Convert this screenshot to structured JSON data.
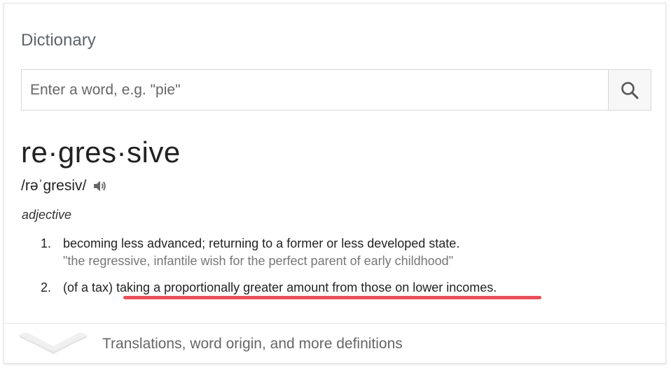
{
  "title": "Dictionary",
  "search": {
    "placeholder": "Enter a word, e.g. \"pie\"",
    "value": "",
    "icon": "search-icon"
  },
  "entry": {
    "headword": "re·gres·sive",
    "pronunciation": "/rəˈɡresiv/",
    "audio_icon": "speaker-icon",
    "part_of_speech": "adjective",
    "definitions": [
      {
        "number": "1.",
        "prefix": "",
        "text": "becoming less advanced; returning to a former or less developed state.",
        "example": "\"the regressive, infantile wish for the perfect parent of early childhood\""
      },
      {
        "number": "2.",
        "prefix": "(of a tax) ",
        "text": "taking a proportionally greater amount from those on lower incomes.",
        "example": ""
      }
    ]
  },
  "footer": {
    "label": "Translations, word origin, and more definitions",
    "icon": "chevron-down-icon"
  },
  "colors": {
    "highlight_underline": "#e8505b",
    "text": "#222222",
    "muted": "#777777"
  }
}
